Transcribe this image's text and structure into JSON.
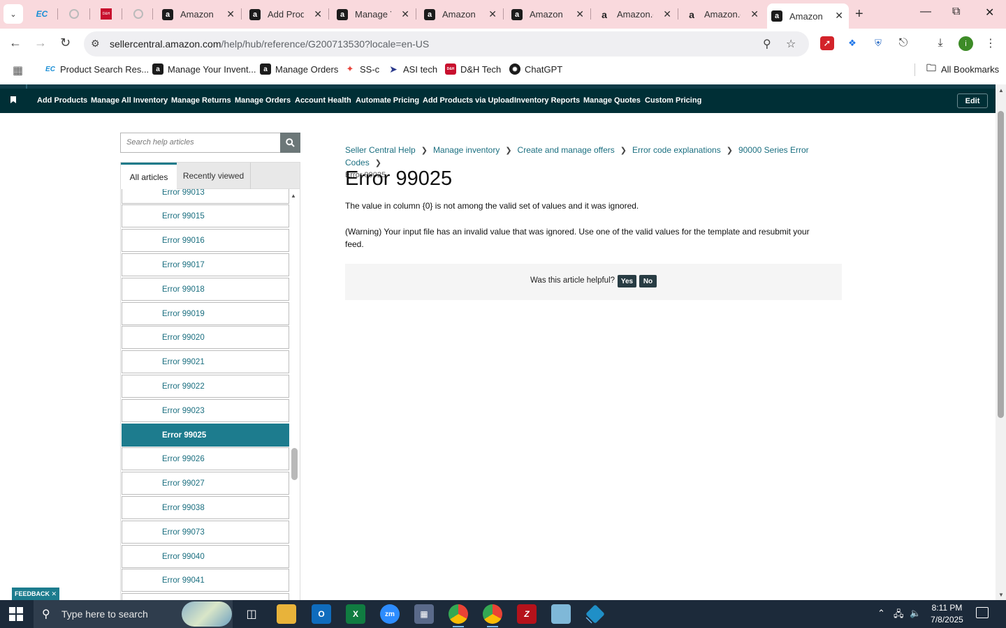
{
  "browser": {
    "tabs": [
      {
        "title": "Amazon"
      },
      {
        "title": "Add Prod"
      },
      {
        "title": "Manage Y"
      },
      {
        "title": "Amazon"
      },
      {
        "title": "Amazon"
      },
      {
        "title": "Amazon.c"
      },
      {
        "title": "Amazon.c"
      },
      {
        "title": "Amazon"
      }
    ],
    "pinned": [
      "EC",
      "",
      "D&H",
      ""
    ],
    "url_host": "sellercentral.amazon.com",
    "url_path": "/help/hub/reference/G200713530?locale=en-US",
    "profile_initial": "i"
  },
  "bookmarks": {
    "items": [
      {
        "label": "Product Search Res...",
        "icon": "EC"
      },
      {
        "label": "Manage Your Invent...",
        "icon": "a"
      },
      {
        "label": "Manage Orders",
        "icon": "a"
      },
      {
        "label": "SS-c",
        "icon": "ss"
      },
      {
        "label": "ASI tech",
        "icon": "asi"
      },
      {
        "label": "D&H Tech",
        "icon": "D&H"
      },
      {
        "label": "ChatGPT",
        "icon": "gpt"
      }
    ],
    "all_label": "All Bookmarks"
  },
  "scnav": {
    "items": [
      "Add Products",
      "Manage All Inventory",
      "Manage Returns",
      "Manage Orders",
      "Account Health",
      "Automate Pricing",
      "Add Products via Upload",
      "Inventory Reports",
      "Manage Quotes",
      "Custom Pricing"
    ],
    "edit": "Edit"
  },
  "help": {
    "search_placeholder": "Search help articles",
    "tab_all": "All articles",
    "tab_recent": "Recently viewed",
    "list": [
      "Error 99013",
      "Error 99015",
      "Error 99016",
      "Error 99017",
      "Error 99018",
      "Error 99019",
      "Error 99020",
      "Error 99021",
      "Error 99022",
      "Error 99023",
      "Error 99025",
      "Error 99026",
      "Error 99027",
      "Error 99038",
      "Error 99073",
      "Error 99040",
      "Error 99041"
    ],
    "active_item": "Error 99025"
  },
  "article": {
    "breadcrumb": [
      "Seller Central Help",
      "Manage inventory",
      "Create and manage offers",
      "Error code explanations",
      "90000 Series Error Codes"
    ],
    "current": "Error 99025",
    "title": "Error 99025",
    "p1": "The value in column {0} is not among the valid set of values and it was ignored.",
    "p2": "(Warning) Your input file has an invalid value that was ignored. Use one of the valid values for the template and resubmit your feed.",
    "helpful_q": "Was this article helpful?",
    "yes": "Yes",
    "no": "No"
  },
  "feedback": "FEEDBACK ✕",
  "taskbar": {
    "search_text": "Type here to search",
    "time": "8:11 PM",
    "date": "7/8/2025"
  },
  "colors": {
    "nav_bg": "#002f36",
    "accent": "#1d7c8e",
    "tabstrip": "#f9d9dd"
  }
}
